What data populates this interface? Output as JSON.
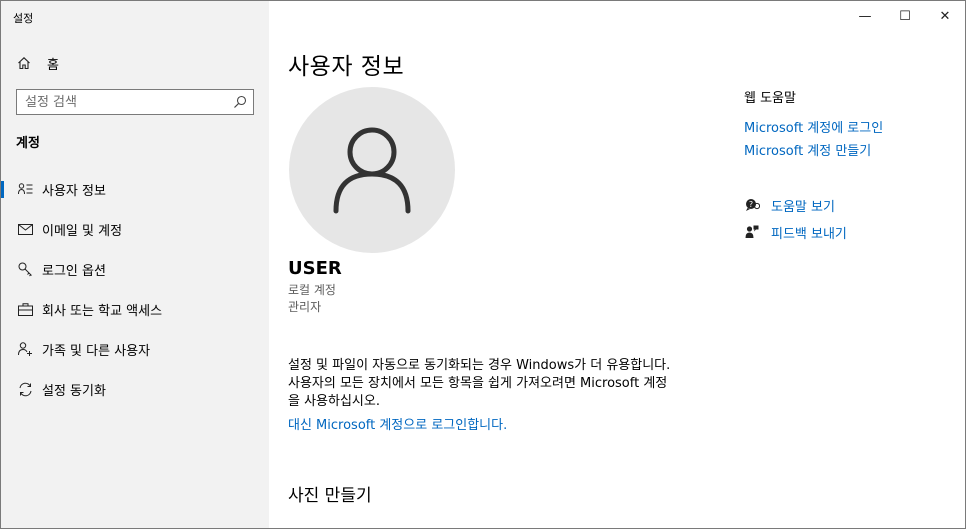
{
  "window": {
    "title": "설정",
    "controls": {
      "minimize": "—",
      "maximize": "☐",
      "close": "✕"
    }
  },
  "sidebar": {
    "home_label": "홈",
    "search_placeholder": "설정 검색",
    "section_title": "계정",
    "items": [
      {
        "label": "사용자 정보",
        "icon": "user-info-icon",
        "active": true
      },
      {
        "label": "이메일 및 계정",
        "icon": "mail-icon",
        "active": false
      },
      {
        "label": "로그인 옵션",
        "icon": "key-icon",
        "active": false
      },
      {
        "label": "회사 또는 학교 액세스",
        "icon": "briefcase-icon",
        "active": false
      },
      {
        "label": "가족 및 다른 사용자",
        "icon": "add-user-icon",
        "active": false
      },
      {
        "label": "설정 동기화",
        "icon": "sync-icon",
        "active": false
      }
    ]
  },
  "main": {
    "title": "사용자 정보",
    "user": {
      "name": "USER",
      "account_type": "로컬 계정",
      "role": "관리자"
    },
    "sync_description": "설정 및 파일이 자동으로 동기화되는 경우 Windows가 더 유용합니다. 사용자의 모든 장치에서 모든 항목을 쉽게 가져오려면 Microsoft 계정을 사용하십시오.",
    "ms_signin_link": "대신 Microsoft 계정으로 로그인합니다.",
    "photo_section_title": "사진 만들기"
  },
  "right_panel": {
    "title": "웹 도움말",
    "links": [
      "Microsoft 계정에 로그인",
      "Microsoft 계정 만들기"
    ],
    "help_label": "도움말 보기",
    "feedback_label": "피드백 보내기"
  },
  "colors": {
    "accent": "#0067c0",
    "sidebar_bg": "#f2f2f2",
    "avatar_bg": "#e6e6e6"
  }
}
